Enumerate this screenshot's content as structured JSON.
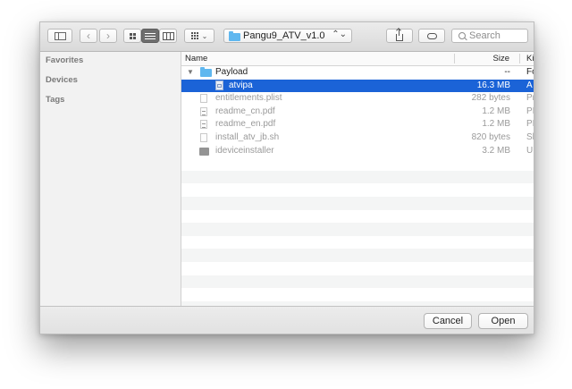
{
  "toolbar": {
    "path_popup": "Pangu9_ATV_v1.0",
    "search_placeholder": "Search",
    "icons": [
      "sidebar-toggle-icon",
      "back-chevron-icon",
      "forward-chevron-icon",
      "icon-view-icon",
      "list-view-icon",
      "column-view-icon",
      "arrange-icon",
      "share-icon",
      "tag-icon",
      "search-icon"
    ],
    "arrow_back": "‹",
    "arrow_forward": "›",
    "updown": "⌃⌄"
  },
  "sidebar": {
    "headings": [
      "Favorites",
      "Devices",
      "Tags"
    ]
  },
  "filelist": {
    "columns": {
      "name": "Name",
      "size": "Size",
      "kind": "Ki"
    },
    "rows": [
      {
        "name": "Payload",
        "size": "--",
        "kind": "Fo",
        "icon": "folder-icon",
        "disclosure": "▼",
        "state": "enabled"
      },
      {
        "name": "atvipa",
        "size": "16.3 MB",
        "kind": "A",
        "icon": "ipa-file-icon",
        "state": "selected"
      },
      {
        "name": "entitlements.plist",
        "size": "282 bytes",
        "kind": "Pr",
        "icon": "document-icon",
        "state": "disabled"
      },
      {
        "name": "readme_cn.pdf",
        "size": "1.2 MB",
        "kind": "PI",
        "icon": "pdf-icon",
        "state": "disabled"
      },
      {
        "name": "readme_en.pdf",
        "size": "1.2 MB",
        "kind": "PI",
        "icon": "pdf-icon",
        "state": "disabled"
      },
      {
        "name": "install_atv_jb.sh",
        "size": "820 bytes",
        "kind": "Sh",
        "icon": "document-icon",
        "state": "disabled"
      },
      {
        "name": "ideviceinstaller",
        "size": "3.2 MB",
        "kind": "U",
        "icon": "executable-icon",
        "state": "disabled"
      }
    ]
  },
  "footer": {
    "cancel_label": "Cancel",
    "open_label": "Open"
  },
  "colors": {
    "selection": "#1b63d7",
    "folder": "#5fb7ef",
    "sidebar_bg": "#f2f2f2"
  }
}
